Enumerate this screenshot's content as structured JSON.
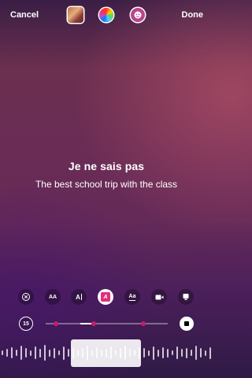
{
  "top_bar": {
    "cancel_label": "Cancel",
    "done_label": "Done",
    "thumbnail": "album-art-thumbnail",
    "color_icon": "color-wheel-icon",
    "sticker_icon": "face-sticker-icon"
  },
  "lyrics": {
    "headline": "Je ne sais pas",
    "subline": "The best school trip with the class"
  },
  "toolbar": {
    "tools": [
      {
        "name": "remove-icon",
        "label": ""
      },
      {
        "name": "font-size-icon",
        "label": "AA"
      },
      {
        "name": "text-style-icon",
        "label": "A"
      },
      {
        "name": "text-color-icon",
        "label": "A",
        "active": true
      },
      {
        "name": "text-case-icon",
        "label": "Aa"
      },
      {
        "name": "video-icon",
        "label": ""
      },
      {
        "name": "card-icon",
        "label": ""
      }
    ]
  },
  "timeline": {
    "duration": "15",
    "accent_color": "#c51f6a"
  }
}
